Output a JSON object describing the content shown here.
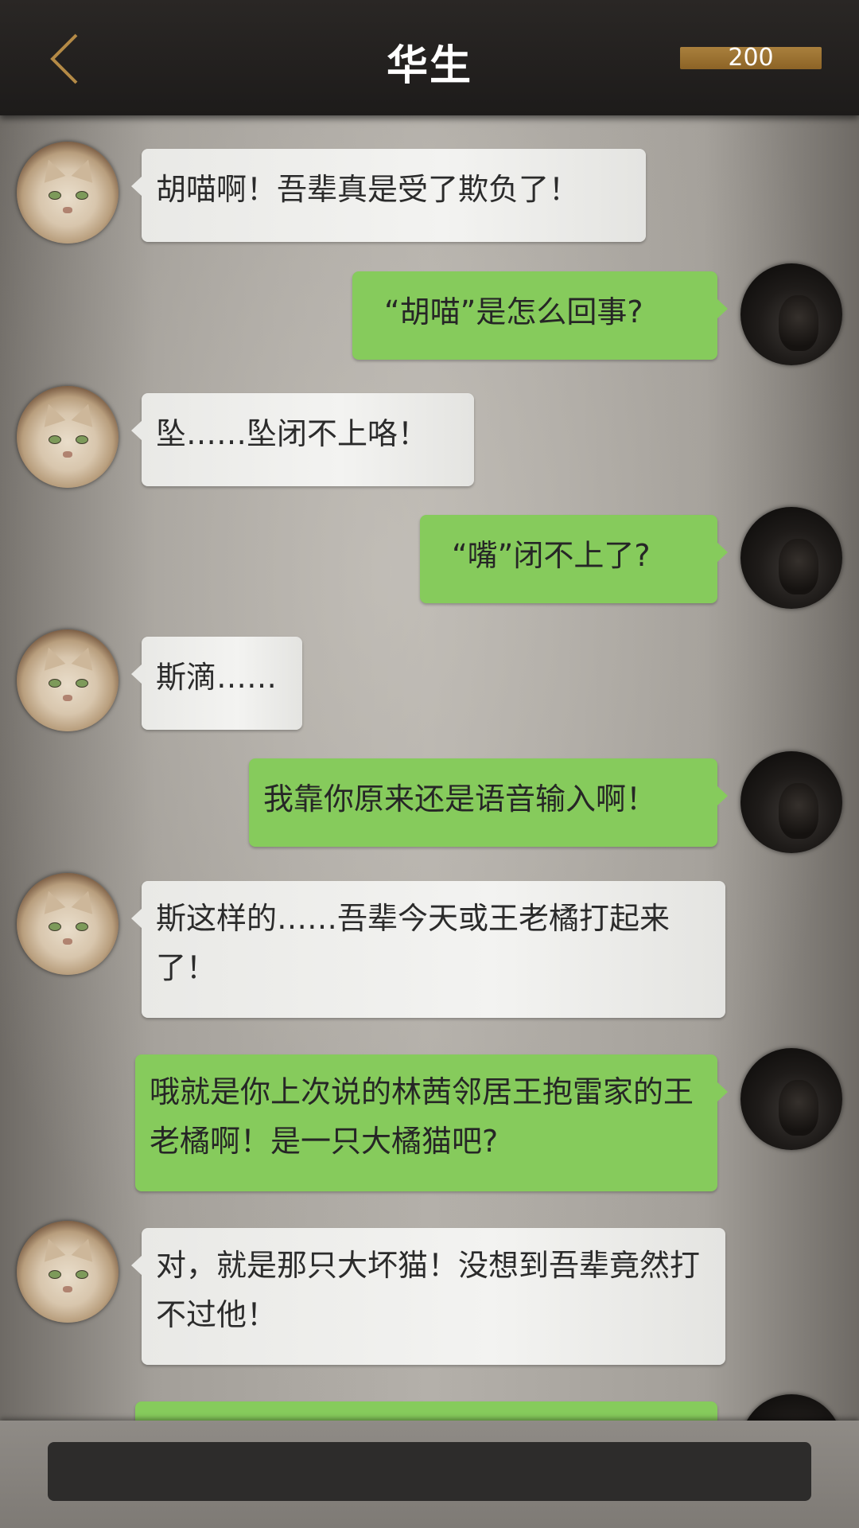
{
  "header": {
    "title": "华生",
    "coin_value": "200"
  },
  "messages": [
    {
      "side": "in",
      "text": "胡喵啊！吾辈真是受了欺负了！"
    },
    {
      "side": "out",
      "text": "“胡喵”是怎么回事?"
    },
    {
      "side": "in",
      "text": "坠……坠闭不上咯！"
    },
    {
      "side": "out",
      "text": "“嘴”闭不上了?"
    },
    {
      "side": "in",
      "text": "斯滴……"
    },
    {
      "side": "out",
      "text": "我靠你原来还是语音输入啊！"
    },
    {
      "side": "in",
      "text": "斯这样的……吾辈今天或王老橘打起来了！"
    },
    {
      "side": "out",
      "text": "哦就是你上次说的林茜邻居王抱雷家的王老橘啊！是一只大橘猫吧?"
    },
    {
      "side": "in",
      "text": "对，就是那只大坏猫！没想到吾辈竟然打不过他！"
    },
    {
      "side": "out",
      "text": ""
    }
  ],
  "colors": {
    "header_bg": "#1d1b1a",
    "outgoing_bubble": "#86cb5c",
    "incoming_bubble": "#f0f0ee",
    "coin_bar": "#9a7130",
    "back_arrow": "#b48a46"
  },
  "icons": {
    "back": "chevron-left-icon",
    "contact_avatar": "cat-avatar",
    "user_avatar": "dark-avatar"
  }
}
